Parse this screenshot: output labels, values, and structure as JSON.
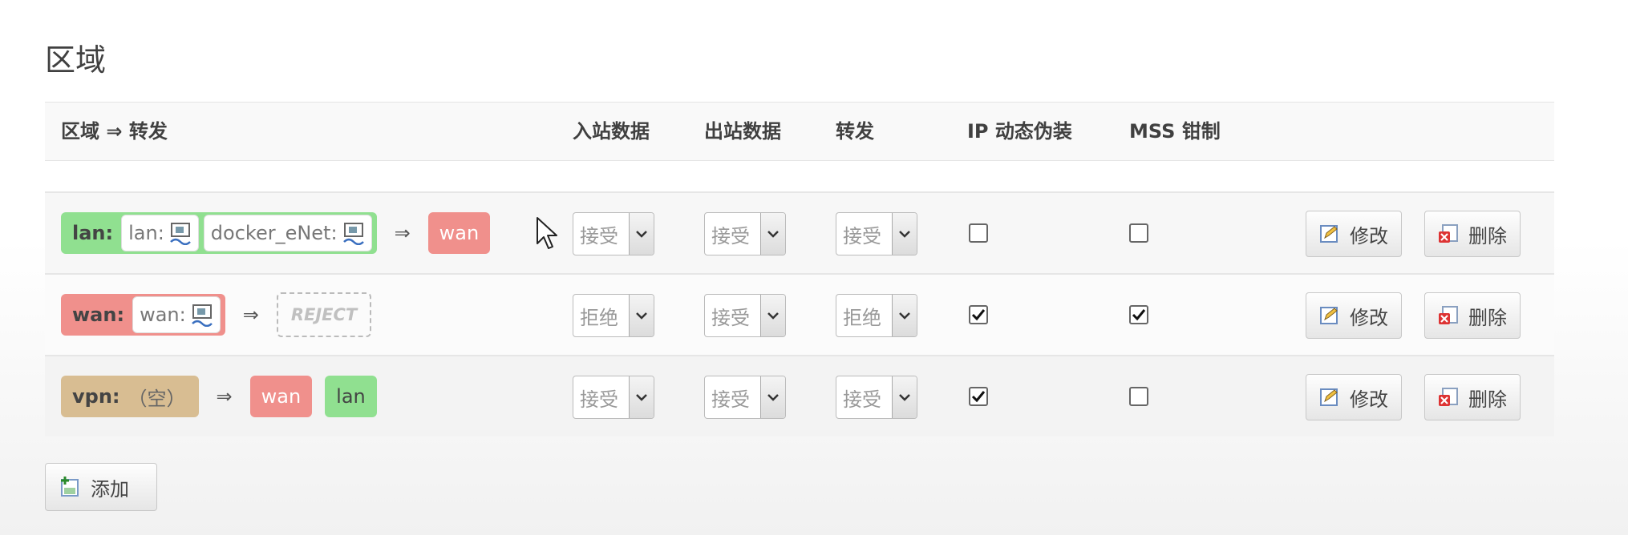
{
  "title": "区域",
  "headers": {
    "zone_forward": "区域 ⇒ 转发",
    "input": "入站数据",
    "output": "出站数据",
    "forward": "转发",
    "masq": "IP 动态伪装",
    "mss": "MSS 钳制"
  },
  "rows": [
    {
      "zone": "lan:",
      "devices": [
        "lan:",
        "docker_eNet:"
      ],
      "arrow": "⇒",
      "dest": [
        "wan"
      ],
      "input": "接受",
      "output": "接受",
      "forward": "接受",
      "masq": false,
      "mss": false
    },
    {
      "zone": "wan:",
      "devices": [
        "wan:"
      ],
      "arrow": "⇒",
      "dest": [
        "REJECT"
      ],
      "input": "拒绝",
      "output": "接受",
      "forward": "拒绝",
      "masq": true,
      "mss": true
    },
    {
      "zone": "vpn:",
      "empty": "（空）",
      "arrow": "⇒",
      "dest": [
        "wan",
        "lan"
      ],
      "input": "接受",
      "output": "接受",
      "forward": "接受",
      "masq": true,
      "mss": false
    }
  ],
  "actions": {
    "edit": "修改",
    "delete": "删除"
  },
  "add_label": "添加",
  "colors": {
    "lan": "#90e090",
    "wan": "#f0908c",
    "vpn": "#d8bd92"
  },
  "icons": {
    "device": "network-device-icon",
    "edit": "edit-icon",
    "delete": "delete-icon",
    "add": "add-icon"
  }
}
